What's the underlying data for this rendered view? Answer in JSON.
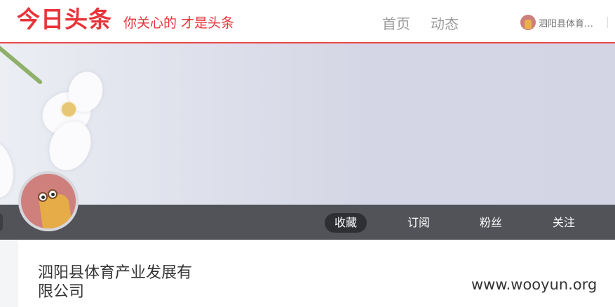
{
  "header": {
    "logo": "今日头条",
    "slogan": "你关心的 才是头条",
    "nav": {
      "home": "首页",
      "feed": "动态"
    },
    "user_name": "泗阳县体育…"
  },
  "tabs": [
    {
      "label": "收藏",
      "active": true
    },
    {
      "label": "订阅",
      "active": false
    },
    {
      "label": "粉丝",
      "active": false
    },
    {
      "label": "关注",
      "active": false
    }
  ],
  "profile": {
    "name": "泗阳县体育产业发展有限公司"
  },
  "watermark": "www.wooyun.org",
  "colors": {
    "brand_red": "#e8343a",
    "tab_bar": "#525358",
    "active_tab": "#2e2f33"
  }
}
